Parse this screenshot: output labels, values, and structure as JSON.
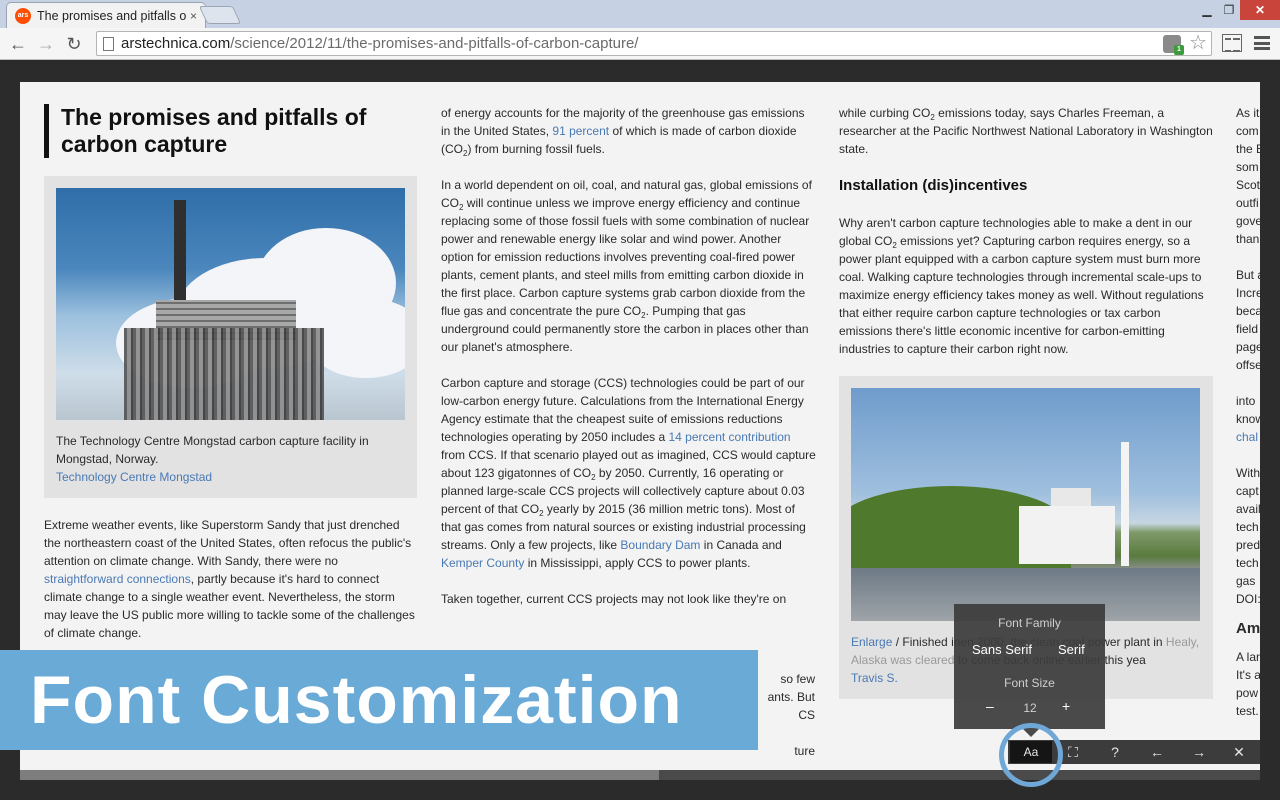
{
  "browser": {
    "tab_title": "The promises and pitfalls of carbon capture",
    "favicon_text": "ars",
    "url_host": "arstechnica.com",
    "url_path": "/science/2012/11/the-promises-and-pitfalls-of-carbon-capture/",
    "icons": [
      "back-icon",
      "forward-icon",
      "reload-icon",
      "page-icon",
      "extension-icon",
      "bookmark-star-icon",
      "reader-view-icon",
      "menu-icon"
    ]
  },
  "article": {
    "headline": "The promises and pitfalls of carbon capture",
    "figure1": {
      "caption": "The Technology Centre Mongstad carbon capture facility in Mongstad, Norway.",
      "credit": "Technology Centre Mongstad"
    },
    "col1": {
      "p1_a": "Extreme weather events, like Superstorm Sandy that just drenched the northeastern coast of the United States, often refocus the public's attention on climate change. With Sandy, there were no ",
      "p1_link": "straightforward connections",
      "p1_b": ", partly because it's hard to connect climate change to a single weather event. Nevertheless, the storm may leave the US public more willing to tackle some of the challenges of climate change."
    },
    "col2": {
      "p1_a": "of energy accounts for the majority of the greenhouse gas emissions in the United States, ",
      "p1_link": "91 percent",
      "p1_b": " of which is made of carbon dioxide (CO",
      "p1_sub": "2",
      "p1_c": ") from burning fossil fuels.",
      "p2_a": "In a world dependent on oil, coal, and natural gas, global emissions of CO",
      "p2_sub": "2",
      "p2_b": " will continue unless we improve energy efficiency and continue replacing some of those fossil fuels with some combination of nuclear power and renewable energy like solar and wind power. Another option for emission reductions involves preventing coal-fired power plants, cement plants, and steel mills from emitting carbon dioxide in the first place. Carbon capture systems grab carbon dioxide from the flue gas and concentrate the pure CO",
      "p2_sub2": "2",
      "p2_c": ". Pumping that gas underground could permanently store the carbon in places other than our planet's atmosphere.",
      "p3_a": "Carbon capture and storage (CCS) technologies could be part of our low-carbon energy future. Calculations from the International Energy Agency estimate that the cheapest suite of emissions reductions technologies operating by 2050 includes a ",
      "p3_link": "14 percent contribution",
      "p3_b": " from CCS. If that scenario played out as imagined, CCS would capture about 123 gigatonnes of CO",
      "p3_sub": "2",
      "p3_c": " by 2050. Currently, 16 operating or planned large-scale CCS projects will collectively capture about 0.03 percent of that CO",
      "p3_sub2": "2",
      "p3_d": " yearly by 2015 (36 million metric tons). Most of that gas comes from natural sources or existing industrial processing streams. Only a few projects, like ",
      "p3_link2": "Boundary Dam",
      "p3_e": " in Canada and ",
      "p3_link3": "Kemper County",
      "p3_f": " in Mississippi, apply CCS to power plants.",
      "p4": "Taken together, current CCS projects may not look like they're on",
      "p4_fragments": [
        "so few",
        "ants. But",
        "CS",
        "ture"
      ]
    },
    "col3": {
      "p1_a": "while curbing CO",
      "p1_sub": "2",
      "p1_b": " emissions today, says Charles Freeman, a researcher at the Pacific Northwest National Laboratory in Washington state.",
      "subhead": "Installation (dis)incentives",
      "p2_a": "Why aren't carbon capture technologies able to make a dent in our global CO",
      "p2_sub": "2",
      "p2_b": " emissions yet? Capturing carbon requires energy, so a power plant equipped with a carbon capture system must burn more coal. Walking capture technologies through incremental scale-ups to maximize energy efficiency takes money as well. Without regulations that either require carbon capture technologies or tax carbon emissions there's little economic incentive for carbon-emitting industries to capture their carbon right now.",
      "figure2": {
        "enlarge": "Enlarge",
        "caption_a": " / Finished in",
        "caption_frag": "en",
        "caption_b": "2000, the clean coal power plant in",
        "caption_faded": " Healy, Alaska was cleared",
        "caption_c": " to come back online earlier this yea",
        "credit": "Travis S."
      }
    },
    "col4": {
      "lines": [
        "As it",
        "com",
        "the E",
        "som",
        "Scot",
        "outfi",
        "gove",
        "than",
        "",
        "But a",
        "Incre",
        "beca",
        "field",
        "page",
        "offse",
        "",
        "into",
        "know",
        "chal",
        "",
        "With",
        "capt",
        "avail",
        "tech",
        "pred",
        "tech",
        "gas",
        "DOI:"
      ],
      "link_line": "chal",
      "subhead": "Am",
      "lines2": [
        "A lar",
        "It's a",
        "pow",
        "test."
      ]
    }
  },
  "font_popup": {
    "family_label": "Font Family",
    "sans": "Sans Serif",
    "serif": "Serif",
    "size_label": "Font Size",
    "minus": "–",
    "size_value": "12",
    "plus": "+"
  },
  "controls": {
    "aa": "Aa",
    "fullscreen": "⛶",
    "help": "?",
    "prev": "←",
    "next": "→",
    "close": "✕"
  },
  "progress_fraction": 0.515,
  "banner": {
    "text": "Font Customization"
  },
  "colors": {
    "link": "#4a79b4",
    "banner": "#6aaad7",
    "ring": "#6fa8d6"
  }
}
